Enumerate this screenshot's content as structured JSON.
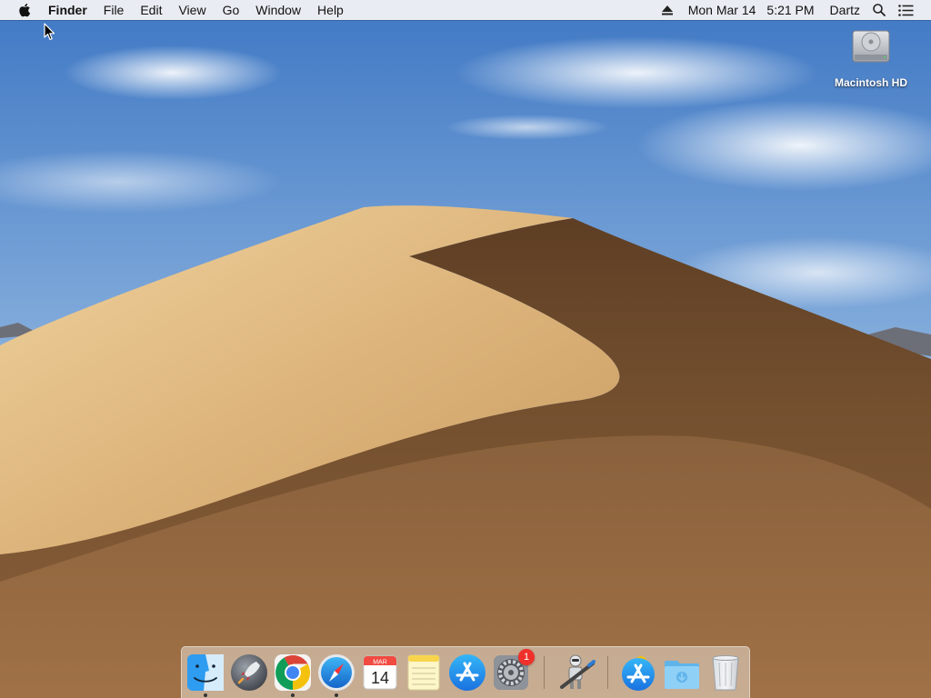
{
  "menubar": {
    "app_name": "Finder",
    "menus": [
      "File",
      "Edit",
      "View",
      "Go",
      "Window",
      "Help"
    ],
    "status": {
      "eject_icon": "eject-icon",
      "date": "Mon Mar 14",
      "time": "5:21 PM",
      "user": "Dartz",
      "spotlight_icon": "search-icon",
      "notification_icon": "list-icon"
    }
  },
  "desktop": {
    "icons": [
      {
        "label": "Macintosh HD",
        "icon": "hard-drive-icon"
      }
    ]
  },
  "dock": {
    "items": [
      {
        "name": "Finder",
        "icon": "finder-icon",
        "running": true
      },
      {
        "name": "Launchpad",
        "icon": "launchpad-icon",
        "running": false
      },
      {
        "name": "Google Chrome",
        "icon": "chrome-icon",
        "running": true
      },
      {
        "name": "Safari",
        "icon": "safari-icon",
        "running": true
      },
      {
        "name": "Calendar",
        "icon": "calendar-icon",
        "running": false,
        "month": "MAR",
        "day": "14"
      },
      {
        "name": "Notes",
        "icon": "notes-icon",
        "running": false
      },
      {
        "name": "App Store",
        "icon": "app-store-icon",
        "running": false
      },
      {
        "name": "System Preferences",
        "icon": "system-preferences-icon",
        "running": false,
        "badge": "1"
      },
      {
        "name": "Automator",
        "icon": "automator-icon",
        "running": false
      },
      {
        "name": "Applications",
        "icon": "applications-folder-icon",
        "running": false
      },
      {
        "name": "Downloads",
        "icon": "downloads-folder-icon",
        "running": false
      },
      {
        "name": "Trash",
        "icon": "trash-icon",
        "running": false
      }
    ]
  },
  "colors": {
    "sky_top": "#3f78c4",
    "sky_bottom": "#cfe0f2",
    "dune_light": "#e6c38c",
    "dune_shadow": "#6e4a2c",
    "badge": "#f0302b"
  }
}
